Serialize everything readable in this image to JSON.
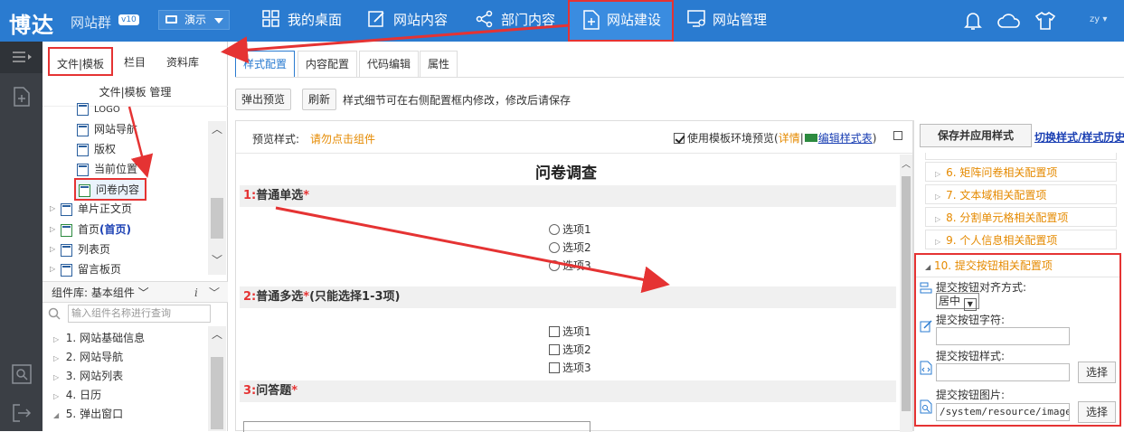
{
  "app": {
    "logo": "博达",
    "logo_sub": "网站群",
    "logo_version": "v10",
    "site_select": "演示",
    "user": "zy"
  },
  "topnav": [
    {
      "label": "我的桌面",
      "icon": "desktop-grid-icon"
    },
    {
      "label": "网站内容",
      "icon": "edit-icon"
    },
    {
      "label": "部门内容",
      "icon": "share-icon"
    },
    {
      "label": "网站建设",
      "icon": "add-page-icon",
      "active": true
    },
    {
      "label": "网站管理",
      "icon": "monitor-gear-icon"
    }
  ],
  "top_icons": [
    "bell-icon",
    "cloud-icon",
    "shirt-icon"
  ],
  "left_panel": {
    "tabs": [
      "文件|模板",
      "栏目",
      "资料库"
    ],
    "header": "文件|模板 管理",
    "tree": [
      {
        "label": "LOGO",
        "level": 2
      },
      {
        "label": "网站导航",
        "level": 2
      },
      {
        "label": "版权",
        "level": 2
      },
      {
        "label": "当前位置",
        "level": 2
      },
      {
        "label": "问卷内容",
        "level": 2,
        "selected": true
      },
      {
        "label": "单片正文页",
        "level": 1
      },
      {
        "label": "首页",
        "suffix": "(首页)",
        "level": 1
      },
      {
        "label": "列表页",
        "level": 1
      },
      {
        "label": "留言板页",
        "level": 1
      }
    ],
    "component_lib": "组件库: 基本组件",
    "component_search_placeholder": "输入组件名称进行查询",
    "components": [
      {
        "num": "1.",
        "label": "网站基础信息"
      },
      {
        "num": "2.",
        "label": "网站导航"
      },
      {
        "num": "3.",
        "label": "网站列表"
      },
      {
        "num": "4.",
        "label": "日历"
      },
      {
        "num": "5.",
        "label": "弹出窗口"
      }
    ]
  },
  "main": {
    "tabs": [
      "样式配置",
      "内容配置",
      "代码编辑",
      "属性"
    ],
    "btn_preview": "弹出预览",
    "btn_refresh": "刷新",
    "hint": "样式细节可在右侧配置框内修改，修改后请保存",
    "preview_label": "预览样式:",
    "preview_hint": "请勿点击组件",
    "use_template_env": "使用模板环境预览",
    "detail_link": "详情",
    "edit_style_link": "编辑样式表",
    "survey": {
      "title": "问卷调查",
      "q1": {
        "num": "1:",
        "label": "普通单选",
        "req": "*",
        "options": [
          "选项1",
          "选项2",
          "选项3"
        ]
      },
      "q2": {
        "num": "2:",
        "label": "普通多选",
        "req": "*",
        "note": "(只能选择1-3项)",
        "options": [
          "选项1",
          "选项2",
          "选项3"
        ]
      },
      "q3": {
        "num": "3:",
        "label": "问答题",
        "req": "*"
      }
    }
  },
  "right_panel": {
    "save_button": "保存并应用样式",
    "switch_link": "切换样式/样式历史",
    "config_items": [
      {
        "label": "6. 矩阵问卷相关配置项"
      },
      {
        "label": "7. 文本域相关配置项"
      },
      {
        "label": "8. 分割单元格相关配置项"
      },
      {
        "label": "9. 个人信息相关配置项"
      }
    ],
    "config10": {
      "title": "10. 提交按钮相关配置项",
      "align_label": "提交按钮对齐方式:",
      "align_value": "居中",
      "text_label": "提交按钮字符:",
      "text_value": "",
      "style_label": "提交按钮样式:",
      "style_value": "",
      "image_label": "提交按钮图片:",
      "image_value": "/system/resource/images/",
      "select_label": "选择"
    }
  },
  "colors": {
    "topbar": "#2a7bd0",
    "highlight": "#e53333",
    "accent_orange": "#e58a00"
  }
}
